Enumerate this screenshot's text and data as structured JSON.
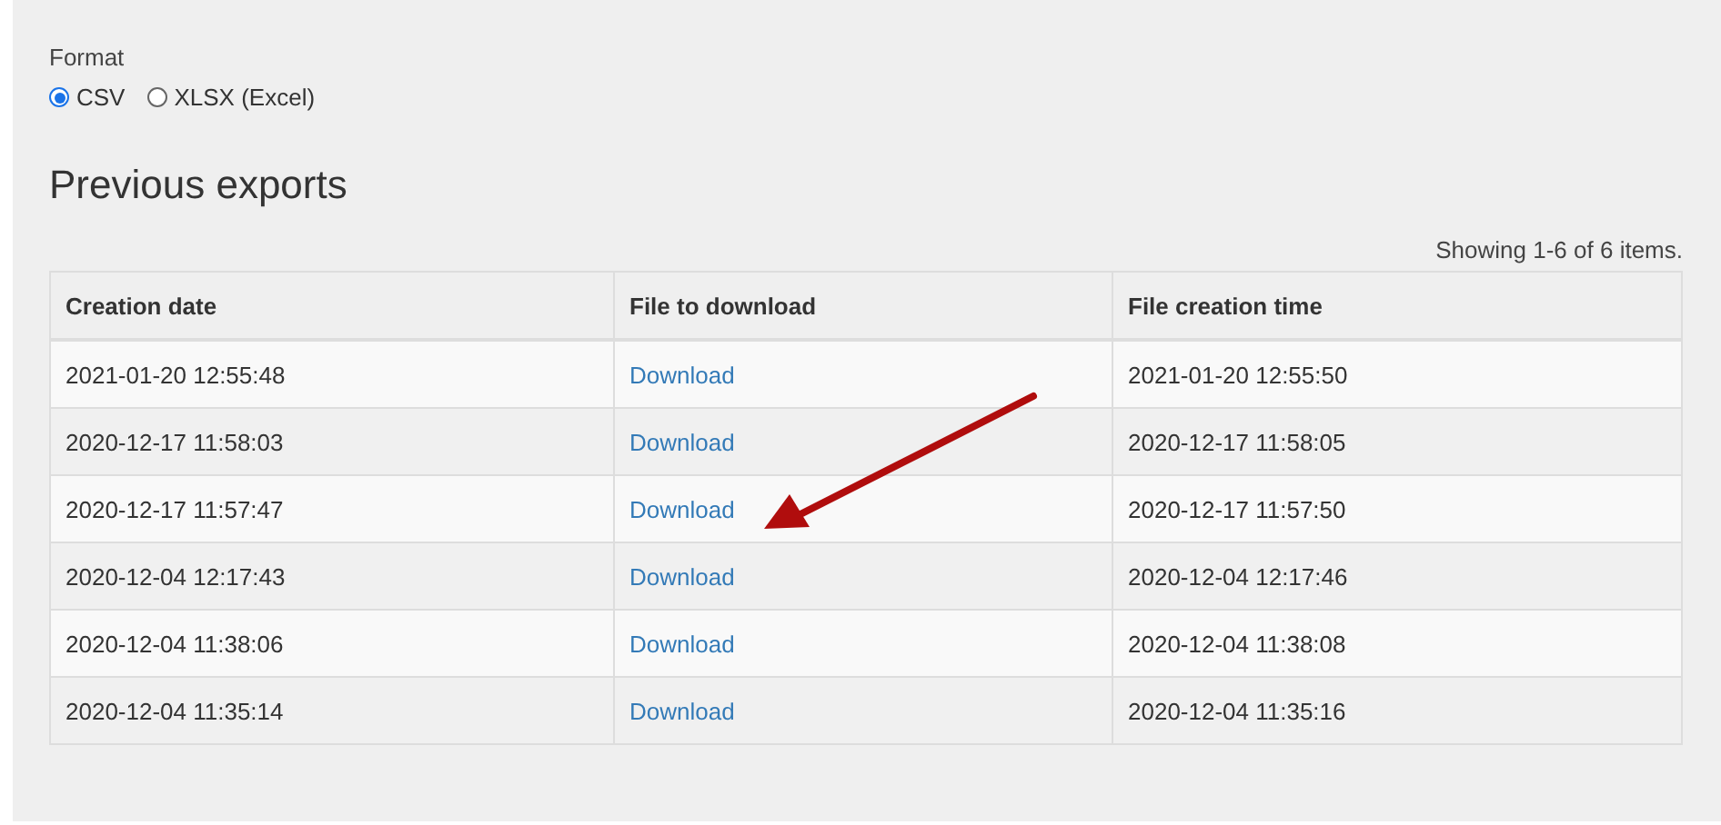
{
  "format": {
    "label": "Format",
    "options": [
      {
        "label": "CSV",
        "selected": true
      },
      {
        "label": "XLSX (Excel)",
        "selected": false
      }
    ]
  },
  "previous_exports": {
    "title": "Previous exports",
    "summary": "Showing 1-6 of 6 items.",
    "table": {
      "columns": [
        "Creation date",
        "File to download",
        "File creation time"
      ],
      "rows": [
        {
          "creation_date": "2021-01-20 12:55:48",
          "file": "Download",
          "file_creation_time": "2021-01-20 12:55:50"
        },
        {
          "creation_date": "2020-12-17 11:58:03",
          "file": "Download",
          "file_creation_time": "2020-12-17 11:58:05"
        },
        {
          "creation_date": "2020-12-17 11:57:47",
          "file": "Download",
          "file_creation_time": "2020-12-17 11:57:50"
        },
        {
          "creation_date": "2020-12-04 12:17:43",
          "file": "Download",
          "file_creation_time": "2020-12-04 12:17:46"
        },
        {
          "creation_date": "2020-12-04 11:38:06",
          "file": "Download",
          "file_creation_time": "2020-12-04 11:38:08"
        },
        {
          "creation_date": "2020-12-04 11:35:14",
          "file": "Download",
          "file_creation_time": "2020-12-04 11:35:16"
        }
      ]
    }
  }
}
